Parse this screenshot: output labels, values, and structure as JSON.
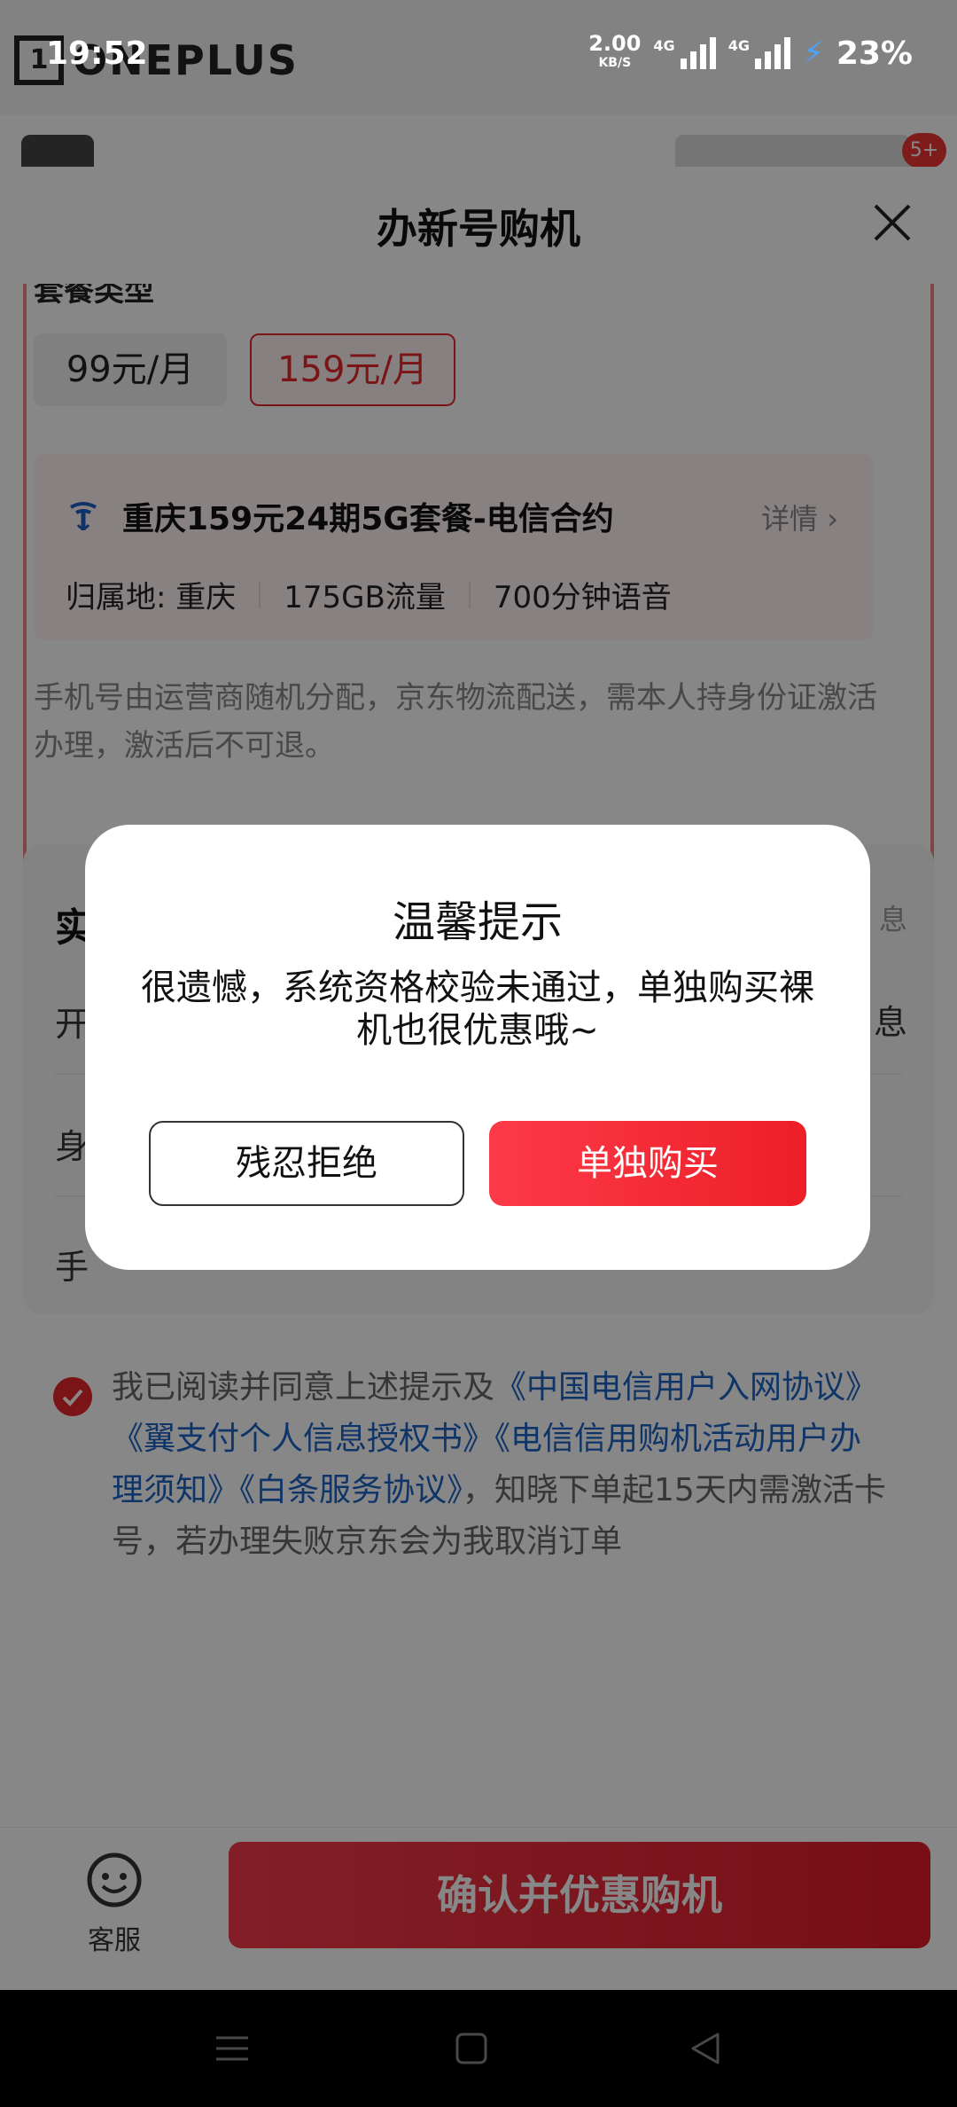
{
  "status_bar": {
    "time": "19:52",
    "net_speed": "2.00",
    "net_unit": "KB/S",
    "sim1_label": "4G",
    "sim2_label": "4G",
    "battery": "23%"
  },
  "background": {
    "brand_logo_text": "ONEPLUS",
    "brand_logo_box": "1",
    "badge": "5+"
  },
  "sheet": {
    "title": "办新号购机",
    "plan_type_label": "套餐类型",
    "options": [
      "99元/月",
      "159元/月"
    ],
    "selected_option": "159元/月",
    "plan_name": "重庆159元24期5G套餐-电信合约",
    "detail_link": "详情 ›",
    "specs": [
      "归属地: 重庆",
      "175GB流量",
      "700分钟语音"
    ],
    "note": "手机号由运营商随机分配，京东物流配送，需本人持身份证激活办理，激活后不可退。"
  },
  "realname": {
    "title": "实",
    "right_top": "息",
    "rows": [
      {
        "label": "开",
        "right": "息"
      },
      {
        "label": "身",
        "right": ""
      },
      {
        "label": "手",
        "right": ""
      }
    ]
  },
  "agreement": {
    "prefix": "我已阅读并同意上述提示及",
    "link1": "《中国电信用户入网协议》",
    "link2": "《翼支付个人信息授权书》",
    "link3": "《电信信用购机活动用户办理须知》",
    "link4": "《白条服务协议》",
    "suffix": "，知晓下单起15天内需激活卡号，若办理失败京东会为我取消订单"
  },
  "bottom": {
    "cs_label": "客服",
    "confirm_label": "确认并优惠购机"
  },
  "dialog": {
    "title": "温馨提示",
    "message": "很遗憾，系统资格校验未通过，单独购买裸机也很优惠哦~",
    "reject_label": "残忍拒绝",
    "buy_label": "单独购买"
  },
  "colors": {
    "accent_red": "#e8262a",
    "link_blue": "#1d63c5"
  }
}
